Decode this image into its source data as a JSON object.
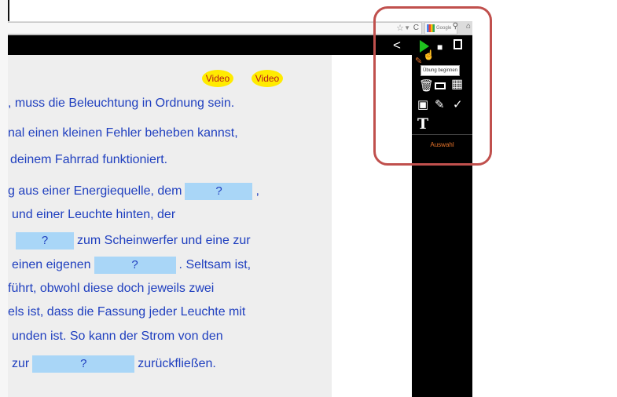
{
  "browser": {
    "search_engine": "Google"
  },
  "content": {
    "video_buttons": [
      "Video",
      "Video"
    ],
    "lines": [
      ", muss die Beleuchtung in Ordnung sein.",
      "nal einen kleinen Fehler beheben kannst,",
      "deinem Fahrrad funktioniert."
    ],
    "gap_placeholder": "?",
    "p2_l1_a": "g aus einer Energiequelle, dem",
    "p2_l1_b": ",",
    "p2_l2": "und einer Leuchte hinten, der",
    "p2_l3_a": "",
    "p2_l3_b": "zum Scheinwerfer und eine zur",
    "p2_l4_a": "einen eigenen",
    "p2_l4_b": ". Seltsam ist,",
    "p2_l5": "führt, obwohl diese doch jeweils zwei",
    "p2_l6": "els ist, dass die Fassung jeder Leuchte mit",
    "p2_l7": "unden ist. So kann der Strom von den",
    "p2_l8_a": "zur",
    "p2_l8_b": "zurückfließen."
  },
  "toolbar": {
    "tooltip": "Übung beginnen",
    "selection_label": "Auswahl",
    "icons": [
      "share-icon",
      "play-icon",
      "camera-icon",
      "panel-toggle-icon",
      "trash-icon",
      "rectangle-icon",
      "grid-icon",
      "image-icon",
      "pencil-icon",
      "check-icon",
      "text-tool-icon"
    ]
  },
  "colors": {
    "highlight": "#c0504d",
    "play": "#1ec11e",
    "gap_fill": "#a9d6f7",
    "text": "#1f3fbf",
    "video_button": "#ffeb00",
    "auswahl": "#e8742a"
  }
}
